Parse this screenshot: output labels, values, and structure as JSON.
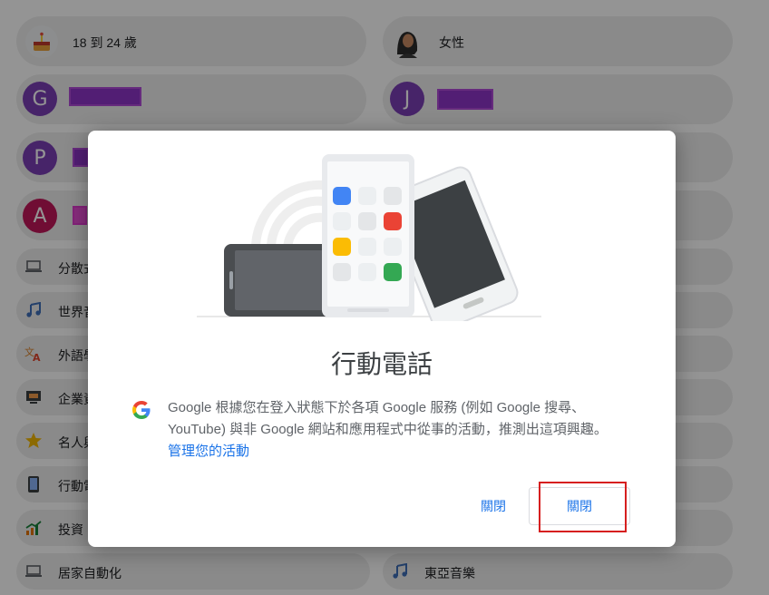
{
  "profile": {
    "age_label": "18 到 24 歲",
    "gender_label": "女性",
    "account_initials": [
      "G",
      "J",
      "P",
      "A"
    ]
  },
  "interests": [
    {
      "label": "分散式",
      "icon": "laptop-icon"
    },
    {
      "label": "世界音",
      "icon": "music-note-icon"
    },
    {
      "label": "外語學",
      "icon": "translate-icon"
    },
    {
      "label": "企業資",
      "icon": "monitor-icon"
    },
    {
      "label": "名人與",
      "icon": "star-icon"
    },
    {
      "label": "行動電",
      "icon": "phone-icon"
    },
    {
      "label": "投資",
      "icon": "chart-icon"
    },
    {
      "label": "居家自動化",
      "icon": "laptop-icon"
    },
    {
      "label": "東亞音樂",
      "icon": "music-note-icon"
    }
  ],
  "dialog": {
    "title": "行動電話",
    "body": "Google 根據您在登入狀態下於各項 Google 服務 (例如 Google 搜尋、YouTube) 與非 Google 網站和應用程式中從事的活動，推測出這項興趣。",
    "manage_link": "管理您的活動",
    "turn_off_label": "關閉",
    "close_label": "關閉"
  },
  "colors": {
    "accent": "#1a73e8",
    "google_blue": "#4285f4",
    "google_red": "#ea4335",
    "google_yellow": "#fbbc04",
    "google_green": "#34a853"
  }
}
